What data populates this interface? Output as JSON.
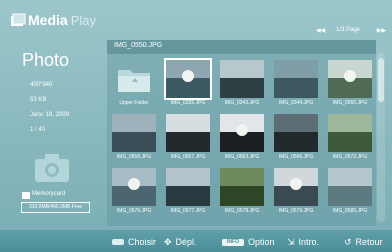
{
  "header": {
    "brand_main": "Media",
    "brand_sub": "Play",
    "pager": {
      "prev_icon": "rewind-icon",
      "text": "1/3 Page",
      "next_icon": "fast-forward-icon"
    }
  },
  "info": {
    "title": "Photo",
    "resolution": "400*340",
    "size": "53 KB",
    "date": "Janv. 18, 2009",
    "index": "1 / 40",
    "storage_label": "Memorycard",
    "storage_free": "315.0MB/495.0MB Free"
  },
  "browser": {
    "current_file": "IMG_0550.JPG",
    "items": [
      {
        "label": "Upper Folder",
        "type": "folder",
        "selected": false
      },
      {
        "label": "IMG_0335.JPG",
        "type": "photo",
        "selected": true
      },
      {
        "label": "IMG_0343.JPG",
        "type": "photo",
        "selected": false
      },
      {
        "label": "IMG_0344.JPG",
        "type": "photo",
        "selected": false
      },
      {
        "label": "IMG_0550.JPG",
        "type": "photo",
        "selected": false
      },
      {
        "label": "IMG_0556.JPG",
        "type": "photo",
        "selected": false
      },
      {
        "label": "IMG_0557.JPG",
        "type": "photo",
        "selected": false
      },
      {
        "label": "IMG_0563.JPG",
        "type": "photo",
        "selected": false
      },
      {
        "label": "IMG_0566.JPG",
        "type": "photo",
        "selected": false
      },
      {
        "label": "IMG_0572.JPG",
        "type": "photo",
        "selected": false
      },
      {
        "label": "IMG_0576.JPG",
        "type": "photo",
        "selected": false
      },
      {
        "label": "IMG_0577.JPG",
        "type": "photo",
        "selected": false
      },
      {
        "label": "IMG_0578.JPG",
        "type": "photo",
        "selected": false
      },
      {
        "label": "IMG_0579.JPG",
        "type": "photo",
        "selected": false
      },
      {
        "label": "IMG_0580.JPG",
        "type": "photo",
        "selected": false
      }
    ]
  },
  "bottombar": {
    "select_label": "Choisir",
    "move_label": "Dépl.",
    "info_key": "INFO",
    "option_label": "Option",
    "intro_label": "Intro.",
    "back_label": "Retour"
  },
  "colors": {
    "accent": "#ffffff",
    "bar": "#4c8f99",
    "background": "#8fbcc2"
  }
}
